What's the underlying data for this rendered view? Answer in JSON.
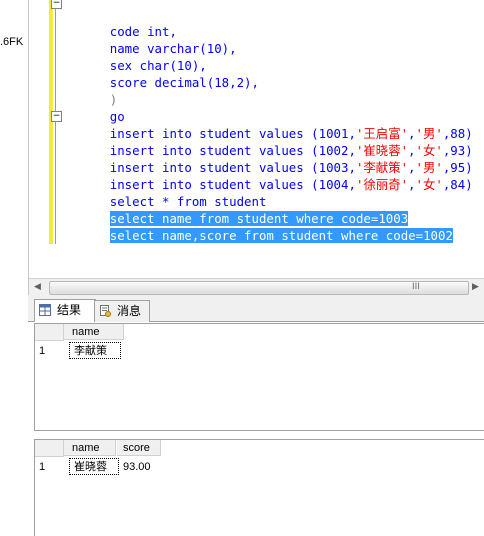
{
  "explorer": {
    "fk_text": ".6FK"
  },
  "editor": {
    "lines": [
      "code int,",
      "name varchar(10),",
      "sex char(10),",
      "score decimal(18,2),",
      ")",
      "go",
      "insert into student values (1001,'王启富','男',88)",
      "insert into student values (1002,'崔晓蓉','女',93)",
      "insert into student values (1003,'李献策','男',95)",
      "insert into student values (1004,'徐丽奇','女',84)",
      "select * from student",
      "select name from student where code=1003",
      "select name,score from student where code=1002"
    ],
    "hscroll_grip": "III"
  },
  "tabs": [
    {
      "label": "结果",
      "icon": "grid-icon",
      "active": true
    },
    {
      "label": "消息",
      "icon": "message-icon",
      "active": false
    }
  ],
  "result1": {
    "columns": [
      "name"
    ],
    "rows": [
      {
        "num": "1",
        "cells": [
          "李献策"
        ]
      }
    ]
  },
  "result2": {
    "columns": [
      "name",
      "score"
    ],
    "rows": [
      {
        "num": "1",
        "cells": [
          "崔晓蓉",
          "93.00"
        ]
      }
    ]
  },
  "colors": {
    "keyword": "#0000ff",
    "string": "#ff0000",
    "selection": "#3399ff",
    "change_bar": "#f5e93a"
  }
}
